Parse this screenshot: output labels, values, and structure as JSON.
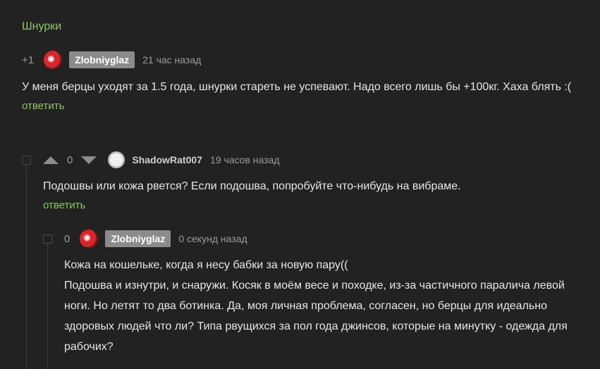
{
  "parent_post": {
    "title": "Шнурки"
  },
  "comments": [
    {
      "rating": "+1",
      "author": "Zlobniyglaz",
      "time": "21 час назад",
      "text": "У меня берцы уходят за 1.5 года, шнурки стареть не успевают. Надо всего лишь бы +100кг. Хаха блять :(",
      "reply_label": "ответить"
    },
    {
      "rating": "0",
      "author": "ShadowRat007",
      "time": "19 часов назад",
      "text": "Подошвы или кожа рвется? Если подошва, попробуйте что-нибудь на вибраме.",
      "reply_label": "ответить"
    },
    {
      "rating": "0",
      "author": "Zlobniyglaz",
      "time": "0 секунд назад",
      "text": "Кожа на кошельке, когда я несу бабки за новую пару((\nПодошва и изнутри, и снаружи. Косяк в моём весе и походке, из-за частичного паралича левой ноги. Но летят то два ботинка. Да, моя личная проблема, согласен, но берцы для идеально здоровых людей что ли? Типа рвущихся за пол года джинсов, которые на минутку - одежда для рабочих?"
    }
  ]
}
